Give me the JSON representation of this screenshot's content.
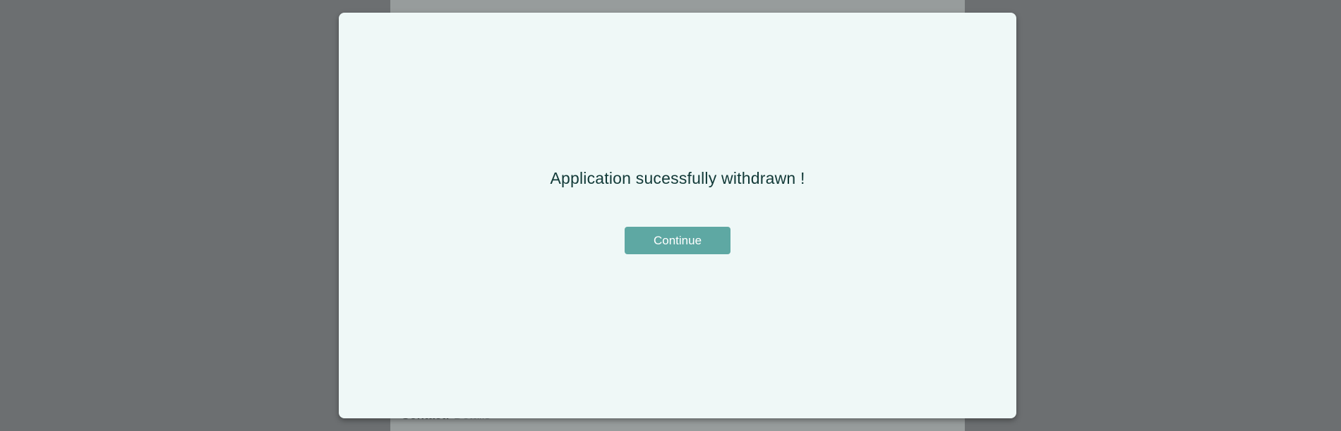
{
  "background": {
    "contact_label": "Contact:",
    "contact_value": "Details"
  },
  "modal": {
    "message": "Application sucessfully withdrawn !",
    "continue_label": "Continue"
  },
  "colors": {
    "overlay": "#9c9fa0",
    "modal_background": "#eff8f7",
    "message_text": "#123a38",
    "button_background": "#5ea8a3",
    "button_text": "#ffffff"
  }
}
